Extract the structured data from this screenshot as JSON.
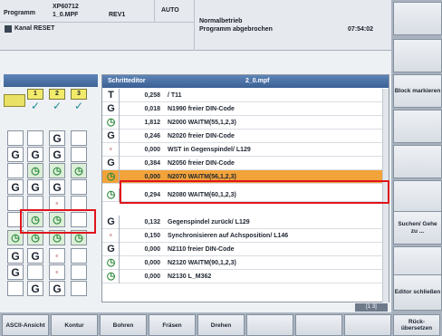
{
  "header": {
    "program_label": "Programm",
    "program_name": "XP60712",
    "program_file": "1_0.MPF",
    "revision": "REV1",
    "mode": "AUTO",
    "channel": "Kanal RESET",
    "status": "Normalbetrieb",
    "message": "Programm abgebrochen",
    "time": "07:54:02"
  },
  "channels": {
    "numbers": [
      "1",
      "2",
      "3"
    ]
  },
  "editor": {
    "title": "Schritteditor",
    "file": "2_0.mpf",
    "rows": [
      {
        "icon": "T",
        "value": "0,258",
        "text": "/ T11"
      },
      {
        "icon": "G",
        "value": "0,018",
        "text": "N1990 freier DIN-Code"
      },
      {
        "icon": "clock",
        "value": "1,812",
        "text": "N2000 WAITM(55,1,2,3)"
      },
      {
        "icon": "G",
        "value": "0,246",
        "text": "N2020 freier DIN-Code"
      },
      {
        "icon": "small",
        "value": "0,000",
        "text": "WST in Gegenspindel/ L129"
      },
      {
        "icon": "G",
        "value": "0,384",
        "text": "N2050 freier DIN-Code"
      },
      {
        "icon": "clock",
        "value": "0,000",
        "text": "N2070 WAITM(56,1,2,3)"
      },
      {
        "icon": "clock",
        "value": "0,294",
        "text": "N2080 WAITM(60,1,2,3)"
      },
      {
        "icon": "G",
        "value": "0,132",
        "text": "Gegenspindel zurück/ L129"
      },
      {
        "icon": "small",
        "value": "0,150",
        "text": "Synchronisieren auf Achsposition/ L146"
      },
      {
        "icon": "G",
        "value": "0,000",
        "text": "N2110 freier DIN-Code"
      },
      {
        "icon": "clock",
        "value": "0,000",
        "text": "N2120 WAITM(90,1,2,3)"
      },
      {
        "icon": "clock",
        "value": "0,000",
        "text": "N2130 L_M362"
      }
    ]
  },
  "softkeys_right": [
    "",
    "",
    "Block markieren",
    "",
    "",
    "",
    "Suchen/ Gehe zu ...",
    "",
    "Editor schließen"
  ],
  "softkeys_bottom": [
    "ASCII-Ansicht",
    "Kontur",
    "Bohren",
    "Fräsen",
    "Drehen",
    "",
    "",
    "",
    "Rück-übersetzen"
  ],
  "pager": "[1 3]",
  "icons": {
    "clock": "clock-icon",
    "g_code": "g-code-icon",
    "tool": "tool-icon",
    "check": "checkmark-icon"
  },
  "colors": {
    "highlight": "#f2a33a",
    "annotation": "#e0141c",
    "titlebar": "#3a5f94"
  }
}
